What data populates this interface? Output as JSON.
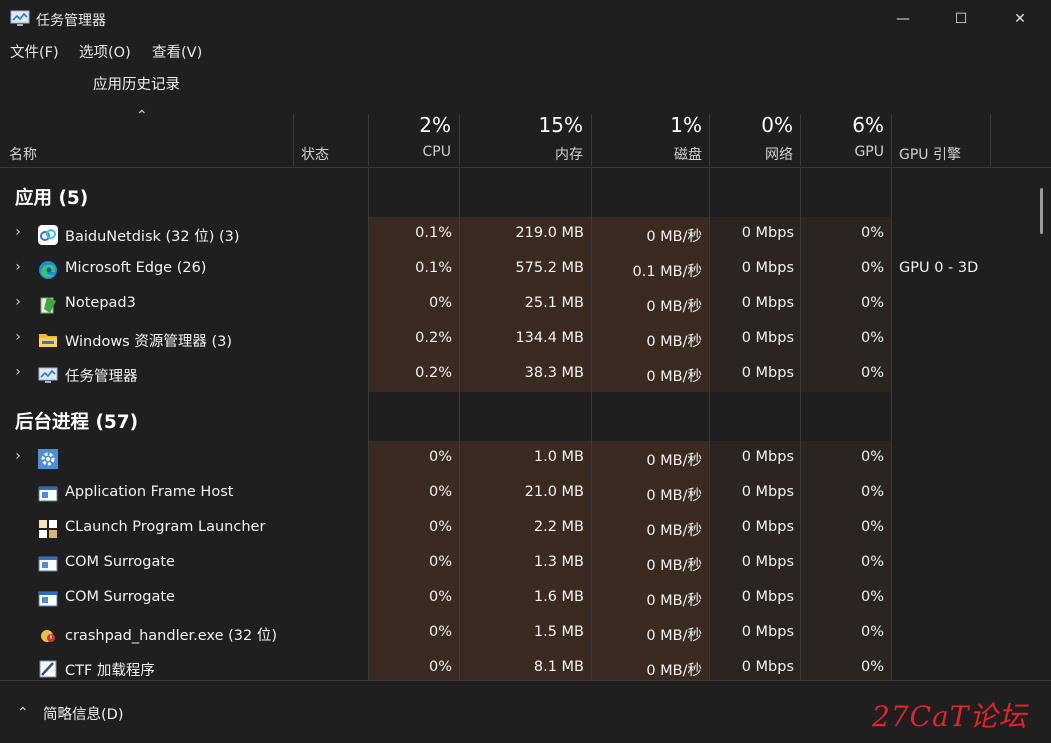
{
  "window": {
    "title": "任务管理器",
    "minimize_glyph": "—",
    "maximize_glyph": "☐",
    "close_glyph": "✕"
  },
  "menu": {
    "file": "文件(F)",
    "options": "选项(O)",
    "view": "查看(V)"
  },
  "tabs": {
    "app_history": "应用历史记录"
  },
  "columns": {
    "name": "名称",
    "status": "状态",
    "cpu": {
      "pct": "2%",
      "label": "CPU"
    },
    "memory": {
      "pct": "15%",
      "label": "内存"
    },
    "disk": {
      "pct": "1%",
      "label": "磁盘"
    },
    "network": {
      "pct": "0%",
      "label": "网络"
    },
    "gpu": {
      "pct": "6%",
      "label": "GPU"
    },
    "gpu_engine": "GPU 引擎"
  },
  "groups": {
    "apps": {
      "title": "应用 (5)"
    },
    "background": {
      "title": "后台进程 (57)"
    }
  },
  "apps": [
    {
      "name": "BaiduNetdisk (32 位) (3)",
      "icon": "baidu-netdisk-icon",
      "cpu": "0.1%",
      "mem": "219.0 MB",
      "disk": "0 MB/秒",
      "net": "0 Mbps",
      "gpu": "0%",
      "gpu_engine": ""
    },
    {
      "name": "Microsoft Edge (26)",
      "icon": "edge-icon",
      "cpu": "0.1%",
      "mem": "575.2 MB",
      "disk": "0.1 MB/秒",
      "net": "0 Mbps",
      "gpu": "0%",
      "gpu_engine": "GPU 0 - 3D"
    },
    {
      "name": "Notepad3",
      "icon": "notepad3-icon",
      "cpu": "0%",
      "mem": "25.1 MB",
      "disk": "0 MB/秒",
      "net": "0 Mbps",
      "gpu": "0%",
      "gpu_engine": ""
    },
    {
      "name": "Windows 资源管理器 (3)",
      "icon": "folder-icon",
      "cpu": "0.2%",
      "mem": "134.4 MB",
      "disk": "0 MB/秒",
      "net": "0 Mbps",
      "gpu": "0%",
      "gpu_engine": ""
    },
    {
      "name": "任务管理器",
      "icon": "task-manager-icon",
      "cpu": "0.2%",
      "mem": "38.3 MB",
      "disk": "0 MB/秒",
      "net": "0 Mbps",
      "gpu": "0%",
      "gpu_engine": ""
    }
  ],
  "background": [
    {
      "name": "",
      "icon": "gear-icon",
      "cpu": "0%",
      "mem": "1.0 MB",
      "disk": "0 MB/秒",
      "net": "0 Mbps",
      "gpu": "0%",
      "expandable": true
    },
    {
      "name": "Application Frame Host",
      "icon": "app-window-icon",
      "cpu": "0%",
      "mem": "21.0 MB",
      "disk": "0 MB/秒",
      "net": "0 Mbps",
      "gpu": "0%",
      "expandable": false
    },
    {
      "name": "CLaunch Program Launcher",
      "icon": "launcher-grid-icon",
      "cpu": "0%",
      "mem": "2.2 MB",
      "disk": "0 MB/秒",
      "net": "0 Mbps",
      "gpu": "0%",
      "expandable": false
    },
    {
      "name": "COM Surrogate",
      "icon": "app-window-icon",
      "cpu": "0%",
      "mem": "1.3 MB",
      "disk": "0 MB/秒",
      "net": "0 Mbps",
      "gpu": "0%",
      "expandable": false
    },
    {
      "name": "COM Surrogate",
      "icon": "app-window-icon",
      "cpu": "0%",
      "mem": "1.6 MB",
      "disk": "0 MB/秒",
      "net": "0 Mbps",
      "gpu": "0%",
      "expandable": false
    },
    {
      "name": "crashpad_handler.exe (32 位)",
      "icon": "crashpad-icon",
      "cpu": "0%",
      "mem": "1.5 MB",
      "disk": "0 MB/秒",
      "net": "0 Mbps",
      "gpu": "0%",
      "expandable": false
    },
    {
      "name": "CTF 加载程序",
      "icon": "ctf-pen-icon",
      "cpu": "0%",
      "mem": "8.1 MB",
      "disk": "0 MB/秒",
      "net": "0 Mbps",
      "gpu": "0%",
      "expandable": false
    }
  ],
  "footer": {
    "fewer_details": "简略信息(D)",
    "watermark": "27CaT论坛"
  },
  "colors": {
    "background": "#1f1f1f",
    "heat_strong": "#3a2a22",
    "heat_weak": "#2c2420",
    "watermark": "#e0242b"
  }
}
